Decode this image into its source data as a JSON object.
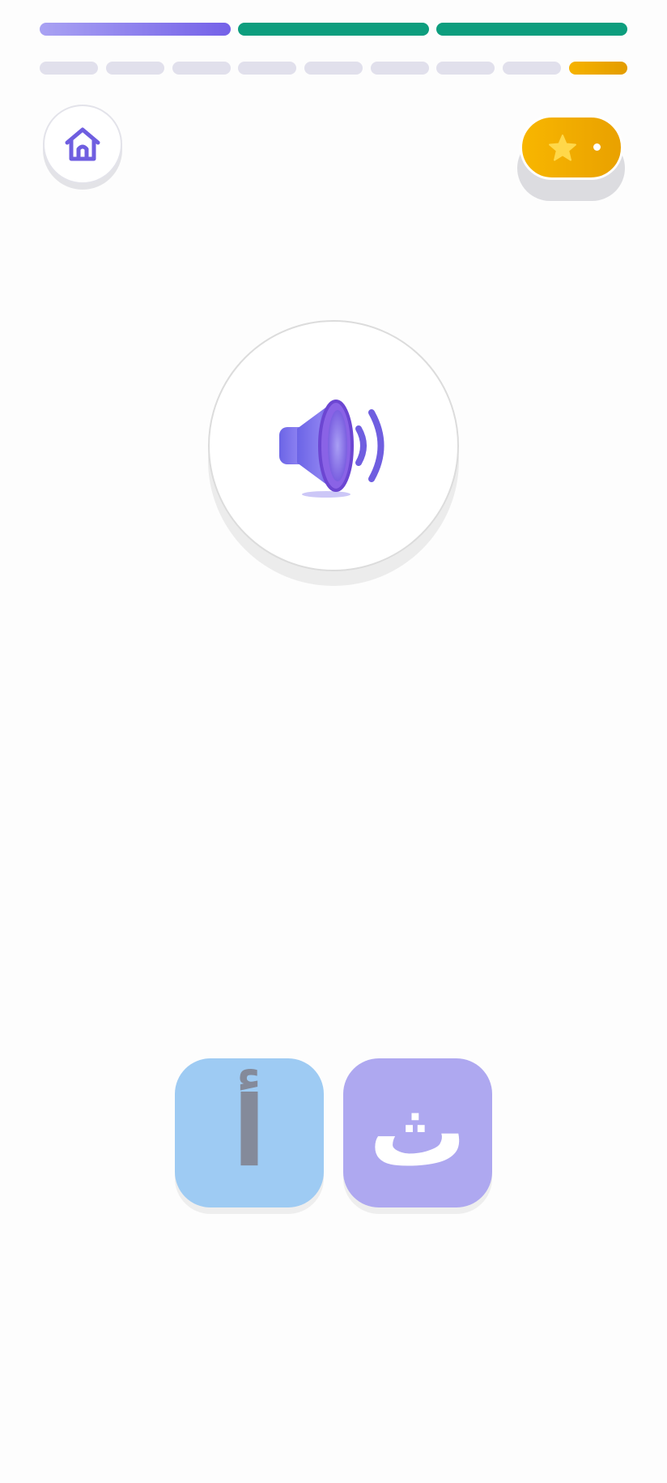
{
  "progress": {
    "top_segments": [
      {
        "state": "current",
        "color_from": "#a9a2f3",
        "color_to": "#7461e8"
      },
      {
        "state": "complete",
        "color": "#0d9e7e"
      },
      {
        "state": "complete",
        "color": "#0d9e7e"
      }
    ],
    "sub_steps": {
      "total": 9,
      "active_index": 8,
      "inactive_color": "#e1e0ec",
      "active_color_from": "#f6b300",
      "active_color_to": "#e39c00"
    }
  },
  "toolbar": {
    "home_icon": "home-icon",
    "home_color": "#6f5ee0",
    "star_icon": "star-icon",
    "star_color": "#ffd84a",
    "star_button_color": "#f4ad00"
  },
  "main": {
    "speaker_icon": "speaker-icon",
    "speaker_color": "#7a6de6"
  },
  "choices": [
    {
      "letter": "أ",
      "bg": "#9ecbf3",
      "fg": "#848a9a"
    },
    {
      "letter": "ث",
      "bg": "#aea8f0",
      "fg": "#ffffff"
    }
  ]
}
